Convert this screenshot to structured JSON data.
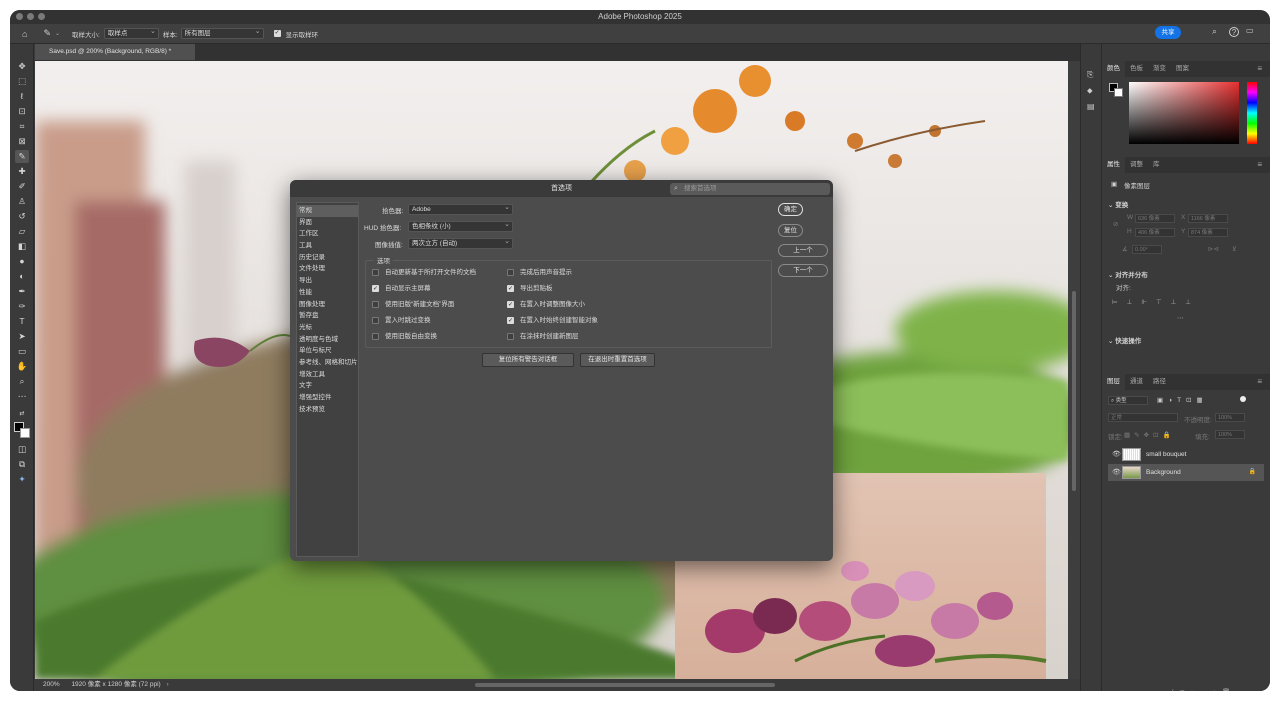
{
  "app": {
    "title": "Adobe Photoshop 2025",
    "share": "共享"
  },
  "options_bar": {
    "sample_size_label": "取样大小:",
    "sample_size_value": "取样点",
    "sample_label": "样本:",
    "sample_value": "所有图层",
    "show_ring_label": "显示取样环",
    "show_ring_checked": true
  },
  "doc": {
    "tab": "Save.psd @ 200% (Background, RGB/8) *",
    "zoom": "200%",
    "info": "1920 像素 x 1280 像素 (72 ppi)"
  },
  "panels": {
    "color_tabs": [
      "颜色",
      "色板",
      "渐变",
      "图案"
    ],
    "props_tabs": [
      "属性",
      "调整",
      "库"
    ],
    "pixel_layer": "像素图层",
    "transform": "变换",
    "transform_fields": {
      "w": "636 像素",
      "x": "1166 像素",
      "h": "406 像素",
      "y": "874 像素",
      "angle": "0.00°"
    },
    "align": "对齐并分布",
    "align_to": "对齐:",
    "quick_actions": "快速操作",
    "layers_tabs": [
      "图层",
      "通道",
      "路径"
    ],
    "kind": "类型",
    "blend": "正常",
    "opacity_label": "不透明度:",
    "opacity": "100%",
    "lock_label": "锁定:",
    "fill_label": "填充:",
    "fill": "100%",
    "layers": [
      {
        "name": "small bouquet"
      },
      {
        "name": "Background"
      }
    ]
  },
  "dialog": {
    "title": "首选项",
    "search_placeholder": "搜索首选项",
    "nav": [
      "常规",
      "界面",
      "工作区",
      "工具",
      "历史记录",
      "文件处理",
      "导出",
      "性能",
      "图像处理",
      "暂存盘",
      "光标",
      "透明度与色域",
      "单位与标尺",
      "参考线、网格和切片",
      "增效工具",
      "文字",
      "增强型控件",
      "技术预览"
    ],
    "nav_selected": 0,
    "color_picker_label": "拾色器:",
    "color_picker_value": "Adobe",
    "hud_label": "HUD 拾色器:",
    "hud_value": "色相条纹 (小)",
    "interp_label": "图像插值:",
    "interp_value": "两次立方 (自动)",
    "options_label": "选项",
    "options_left": [
      {
        "label": "自动更新基于所打开文件的文档",
        "checked": false
      },
      {
        "label": "自动显示主屏幕",
        "checked": true
      },
      {
        "label": "使用旧版“新建文档”界面",
        "checked": false
      },
      {
        "label": "置入时跳过变换",
        "checked": false
      },
      {
        "label": "使用旧版自由变换",
        "checked": false
      }
    ],
    "options_right": [
      {
        "label": "完成后用声音提示",
        "checked": false
      },
      {
        "label": "导出剪贴板",
        "checked": true
      },
      {
        "label": "在置入时调整图像大小",
        "checked": true
      },
      {
        "label": "在置入时始终创建智能对象",
        "checked": true
      },
      {
        "label": "在涂抹时创建新图层",
        "checked": false
      }
    ],
    "reset_warnings": "复位所有警告对话框",
    "reset_on_quit": "在退出时重置首选项",
    "ok": "确定",
    "reset": "复位",
    "prev": "上一个",
    "next": "下一个"
  }
}
